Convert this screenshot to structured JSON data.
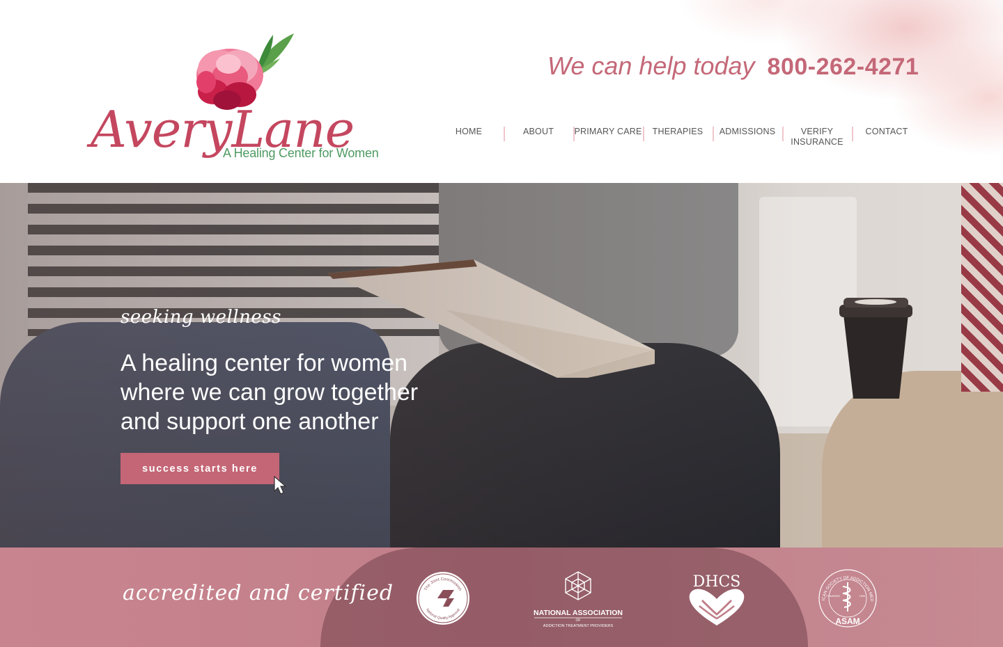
{
  "header": {
    "logo": {
      "name": "AveryLane",
      "tagline": "A Healing Center for Women"
    },
    "help_text": "We can help today",
    "phone": "800-262-4271",
    "nav": [
      {
        "label": "HOME"
      },
      {
        "label": "ABOUT"
      },
      {
        "label": "PRIMARY CARE"
      },
      {
        "label": "THERAPIES"
      },
      {
        "label": "ADMISSIONS"
      },
      {
        "label": "VERIFY INSURANCE"
      },
      {
        "label": "CONTACT"
      }
    ]
  },
  "hero": {
    "eyebrow": "seeking wellness",
    "headline_lines": [
      "A healing center for women",
      "where we can grow together",
      "and support one another"
    ],
    "cta_label": "success starts here"
  },
  "accreditation": {
    "label": "accredited and certified",
    "logos": [
      {
        "icon": "joint-commission-seal-icon",
        "text_top": "The Joint Commission",
        "text_bottom": "National Quality Approval"
      },
      {
        "icon": "naatp-logo-icon",
        "line1": "NATIONAL ASSOCIATION",
        "line2": "OF",
        "line3": "ADDICTION TREATMENT PROVIDERS"
      },
      {
        "icon": "dhcs-logo-icon",
        "text": "DHCS"
      },
      {
        "icon": "asam-seal-icon",
        "ring_text": "AMERICAN SOCIETY OF ADDICTION MEDICINE",
        "founded": "FOUNDED",
        "year": "1954",
        "abbr": "ASAM"
      }
    ]
  },
  "colors": {
    "brand_rose": "#c4475f",
    "accent_pink": "#c46676",
    "leaf_green": "#4f9a62",
    "band": "#c07f89"
  }
}
